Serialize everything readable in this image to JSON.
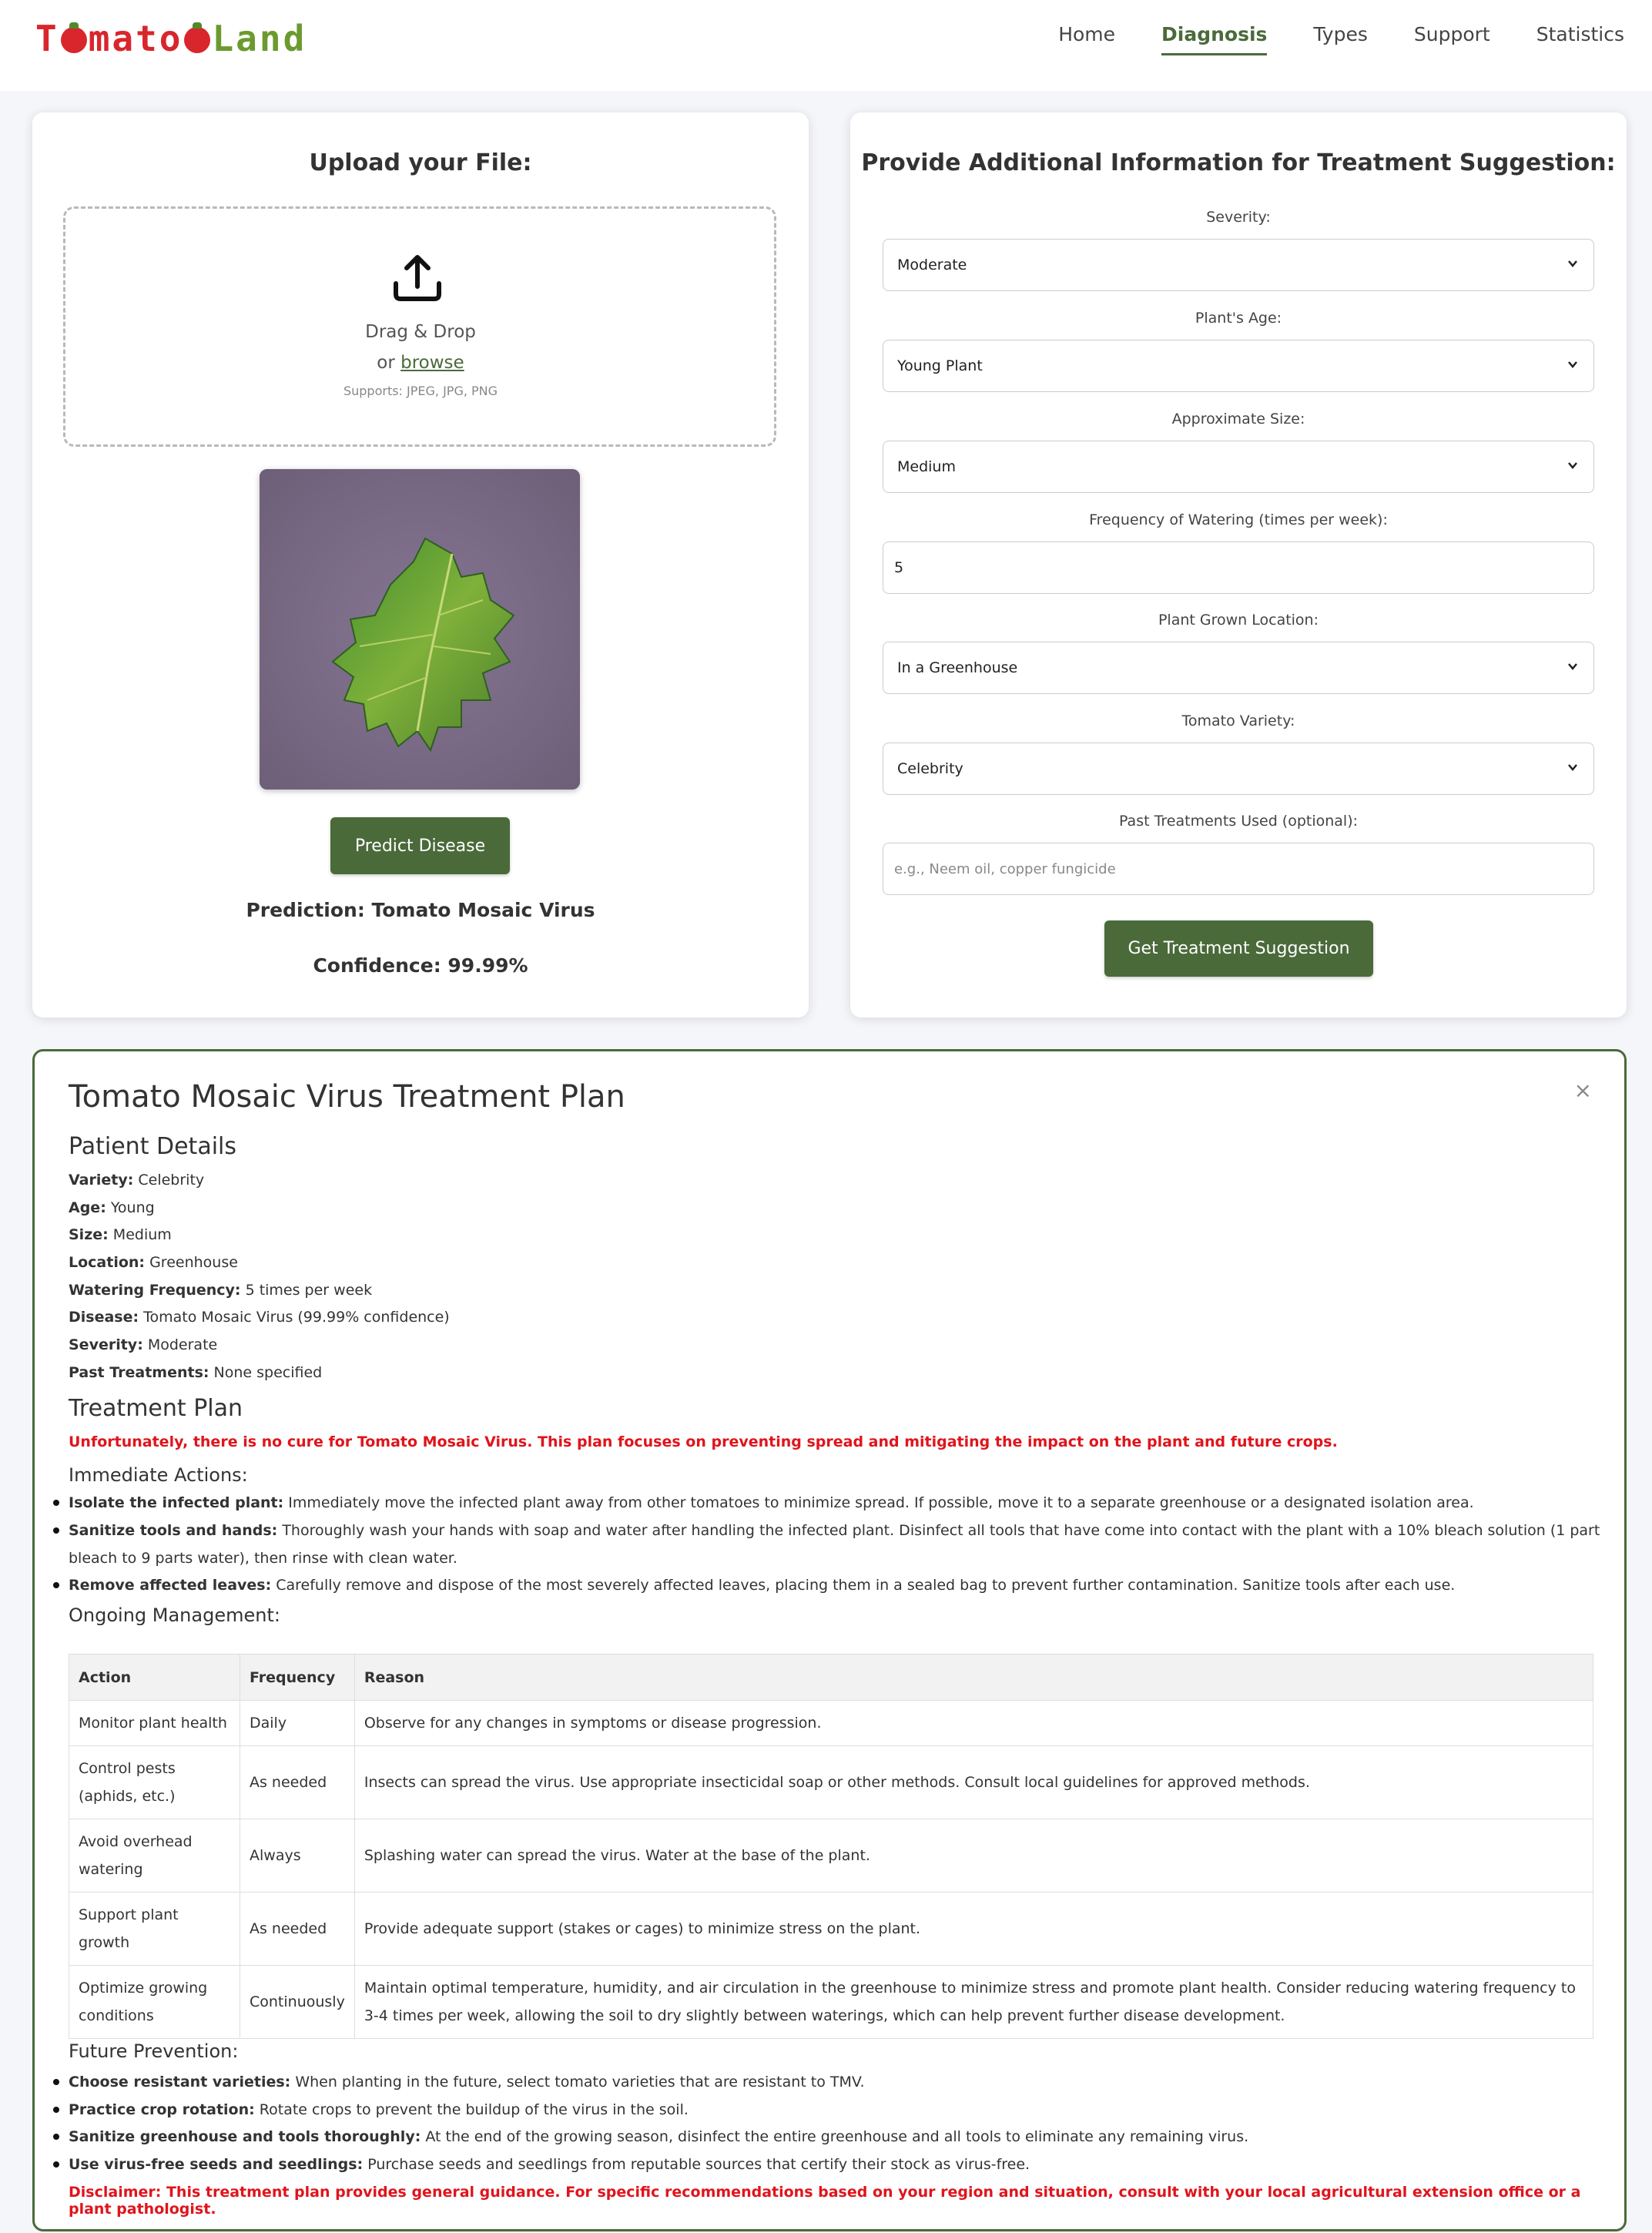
{
  "nav": {
    "logo_parts": [
      "T",
      "o",
      "mato",
      "o",
      "Land"
    ],
    "links": [
      "Home",
      "Diagnosis",
      "Types",
      "Support",
      "Statistics"
    ],
    "active": "Diagnosis"
  },
  "upload": {
    "title": "Upload your File:",
    "drag_text": "Drag & Drop",
    "or_text": "or",
    "browse_text": "browse",
    "supports_text": "Supports: JPEG, JPG, PNG",
    "predict_button": "Predict Disease",
    "prediction": "Prediction: Tomato Mosaic Virus",
    "confidence": "Confidence: 99.99%"
  },
  "info_form": {
    "title": "Provide Additional Information for Treatment Suggestion:",
    "severity_label": "Severity:",
    "severity_value": "Moderate",
    "age_label": "Plant's Age:",
    "age_value": "Young Plant",
    "size_label": "Approximate Size:",
    "size_value": "Medium",
    "watering_label": "Frequency of Watering (times per week):",
    "watering_value": "5",
    "location_label": "Plant Grown Location:",
    "location_value": "In a Greenhouse",
    "variety_label": "Tomato Variety:",
    "variety_value": "Celebrity",
    "past_label": "Past Treatments Used (optional):",
    "past_placeholder": "e.g., Neem oil, copper fungicide",
    "submit_button": "Get Treatment Suggestion"
  },
  "plan": {
    "close_symbol": "×",
    "title": "Tomato Mosaic Virus Treatment Plan",
    "patient_heading": "Patient Details",
    "details": [
      {
        "k": "Variety:",
        "v": "Celebrity"
      },
      {
        "k": "Age:",
        "v": "Young"
      },
      {
        "k": "Size:",
        "v": "Medium"
      },
      {
        "k": "Location:",
        "v": "Greenhouse"
      },
      {
        "k": "Watering Frequency:",
        "v": "5 times per week"
      },
      {
        "k": "Disease:",
        "v": "Tomato Mosaic Virus (99.99% confidence)"
      },
      {
        "k": "Severity:",
        "v": "Moderate"
      },
      {
        "k": "Past Treatments:",
        "v": "None specified"
      }
    ],
    "treatment_heading": "Treatment Plan",
    "warning": "Unfortunately, there is no cure for Tomato Mosaic Virus. This plan focuses on preventing spread and mitigating the impact on the plant and future crops.",
    "immediate_heading": "Immediate Actions:",
    "immediate": [
      {
        "k": "Isolate the infected plant:",
        "v": "Immediately move the infected plant away from other tomatoes to minimize spread. If possible, move it to a separate greenhouse or a designated isolation area."
      },
      {
        "k": "Sanitize tools and hands:",
        "v": "Thoroughly wash your hands with soap and water after handling the infected plant. Disinfect all tools that have come into contact with the plant with a 10% bleach solution (1 part bleach to 9 parts water), then rinse with clean water."
      },
      {
        "k": "Remove affected leaves:",
        "v": "Carefully remove and dispose of the most severely affected leaves, placing them in a sealed bag to prevent further contamination. Sanitize tools after each use."
      }
    ],
    "ongoing_heading": "Ongoing Management:",
    "table_headers": [
      "Action",
      "Frequency",
      "Reason"
    ],
    "table_rows": [
      [
        "Monitor plant health",
        "Daily",
        "Observe for any changes in symptoms or disease progression."
      ],
      [
        "Control pests (aphids, etc.)",
        "As needed",
        "Insects can spread the virus. Use appropriate insecticidal soap or other methods. Consult local guidelines for approved methods."
      ],
      [
        "Avoid overhead watering",
        "Always",
        "Splashing water can spread the virus. Water at the base of the plant."
      ],
      [
        "Support plant growth",
        "As needed",
        "Provide adequate support (stakes or cages) to minimize stress on the plant."
      ],
      [
        "Optimize growing conditions",
        "Continuously",
        "Maintain optimal temperature, humidity, and air circulation in the greenhouse to minimize stress and promote plant health. Consider reducing watering frequency to 3-4 times per week, allowing the soil to dry slightly between waterings, which can help prevent further disease development."
      ]
    ],
    "future_heading": "Future Prevention:",
    "future": [
      {
        "k": "Choose resistant varieties:",
        "v": "When planting in the future, select tomato varieties that are resistant to TMV."
      },
      {
        "k": "Practice crop rotation:",
        "v": "Rotate crops to prevent the buildup of the virus in the soil."
      },
      {
        "k": "Sanitize greenhouse and tools thoroughly:",
        "v": "At the end of the growing season, disinfect the entire greenhouse and all tools to eliminate any remaining virus."
      },
      {
        "k": "Use virus-free seeds and seedlings:",
        "v": "Purchase seeds and seedlings from reputable sources that certify their stock as virus-free."
      }
    ],
    "disclaimer": "Disclaimer: This treatment plan provides general guidance. For specific recommendations based on your region and situation, consult with your local agricultural extension office or a plant pathologist."
  },
  "colors": {
    "accent_green": "#4a6a3a",
    "logo_red": "#d8262c",
    "warning_red": "#e0141c"
  }
}
